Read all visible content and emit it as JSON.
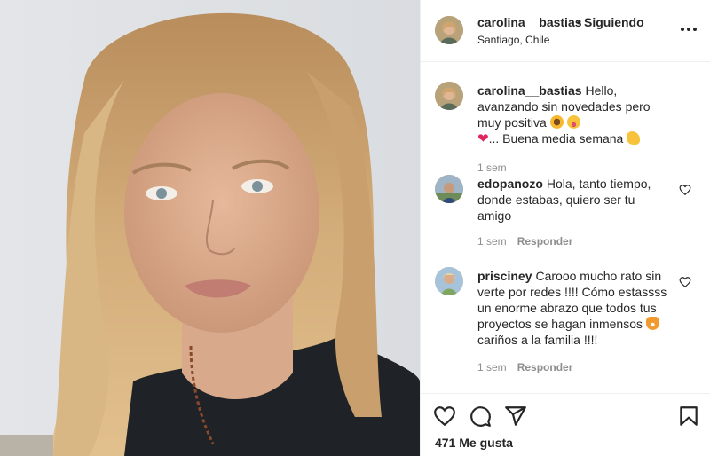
{
  "post": {
    "username": "carolina__bastias",
    "separator": "•",
    "follow_status": "Siguiendo",
    "location": "Santiago, Chile"
  },
  "caption": {
    "username": "carolina__bastias",
    "text_part1": "Hello, avanzando sin novedades pero muy positiva",
    "text_part2": "... Buena media semana",
    "time": "1 sem"
  },
  "comments": [
    {
      "username": "edopanozo",
      "text": "Hola, tanto tiempo, donde estabas, quiero ser tu amigo",
      "time": "1 sem",
      "reply_label": "Responder"
    },
    {
      "username": "prisciney",
      "text": "Carooo mucho rato sin verte por redes !!!! Cómo estassss un enorme abrazo que todos tus proyectos se hagan inmensos",
      "text_after_emoji": "cariños a la familia !!!!",
      "time": "1 sem",
      "reply_label": "Responder"
    }
  ],
  "actions": {
    "icons": [
      "heart-icon",
      "comment-icon",
      "share-icon",
      "bookmark-icon"
    ],
    "likes": "471 Me gusta"
  },
  "colors": {
    "text": "#262626",
    "muted": "#8e8e8e",
    "border": "#efefef",
    "red_heart": "#e0245e"
  }
}
